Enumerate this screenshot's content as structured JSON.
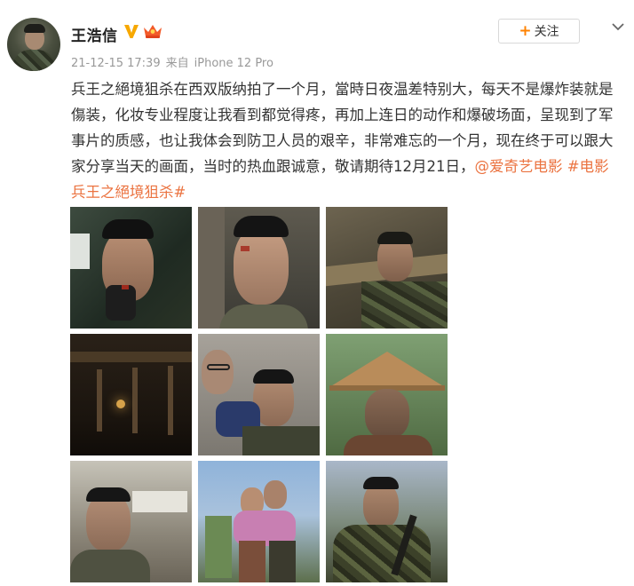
{
  "post": {
    "username": "王浩信",
    "timestamp": "21-12-15 17:39",
    "source_prefix": "来自",
    "source_device": "iPhone 12 Pro",
    "follow_label": "关注",
    "follow_icon": "plus-icon",
    "text_main": "兵王之絕境狙杀在西双版纳拍了一个月，當時日夜温差特别大，每天不是爆炸装就是傷装，化妆专业程度让我看到都觉得疼，再加上连日的动作和爆破场面，呈现到了军事片的质感，也让我体会到防卫人员的艰辛，非常难忘的一个月，现在终于可以跟大家分享当天的画面，当时的热血跟诚意，敬请期待12月21日，",
    "mention": "@爱奇艺电影",
    "hashtag": "#电影兵王之絕境狙杀#",
    "image_count": 9,
    "images": [
      "photo-1",
      "photo-2",
      "photo-3",
      "photo-4",
      "photo-5",
      "photo-6",
      "photo-7",
      "photo-8",
      "photo-9"
    ]
  },
  "icons": {
    "verified": "verified-v-icon",
    "vip": "crown-vip-icon",
    "more": "chevron-down-icon"
  },
  "colors": {
    "link": "#eb7340",
    "follow_plus": "#ff8200",
    "verified": "#f7a800",
    "meta": "#999999"
  }
}
